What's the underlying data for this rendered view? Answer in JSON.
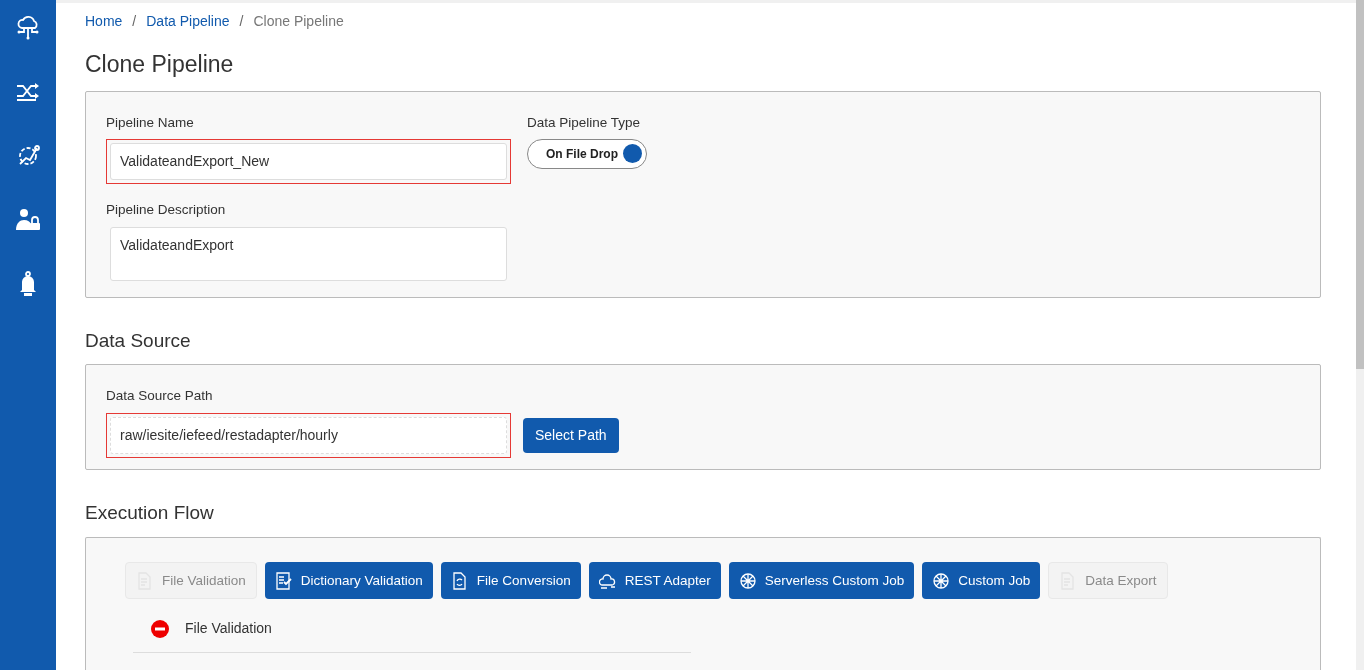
{
  "sidebar": {
    "items": [
      {
        "kind": "cloud"
      },
      {
        "kind": "shuffle"
      },
      {
        "kind": "gear"
      },
      {
        "kind": "user-lock"
      },
      {
        "kind": "bell"
      }
    ]
  },
  "breadcrumb": [
    {
      "label": "Home",
      "current": false
    },
    {
      "separator": "/",
      "label": "Data Pipeline",
      "current": false
    },
    {
      "separator": "/",
      "label": "Clone Pipeline",
      "current": true
    }
  ],
  "page_title": "Clone Pipeline",
  "pipeline": {
    "name_label": "Pipeline Name",
    "name_value": "ValidateandExport_New",
    "name_invalid": true,
    "type_label": "Data Pipeline Type",
    "type_toggle": {
      "label": "On File Drop",
      "on": true
    },
    "description_label": "Pipeline Description",
    "description_value": "ValidateandExport"
  },
  "data_source": {
    "heading": "Data Source",
    "path_label": "Data Source Path",
    "path_value": "raw/iesite/iefeed/restadapter/hourly",
    "path_invalid": true,
    "button": "Select Path"
  },
  "execution_flow": {
    "heading": "Execution Flow",
    "jobs": [
      {
        "label": "File Validation",
        "kind": "doc",
        "disabled": true
      },
      {
        "label": "Dictionary Validation",
        "kind": "dictionary",
        "disabled": false
      },
      {
        "label": "File Conversion",
        "kind": "conversion",
        "disabled": false
      },
      {
        "label": "REST Adapter",
        "kind": "rest",
        "disabled": false
      },
      {
        "label": "Serverless Custom Job",
        "kind": "custom",
        "disabled": false
      },
      {
        "label": "Custom Job",
        "kind": "custom",
        "disabled": false
      },
      {
        "label": "Data Export",
        "kind": "doc",
        "disabled": true
      }
    ],
    "steps": [
      {
        "label": "File Validation",
        "error": true
      }
    ]
  }
}
